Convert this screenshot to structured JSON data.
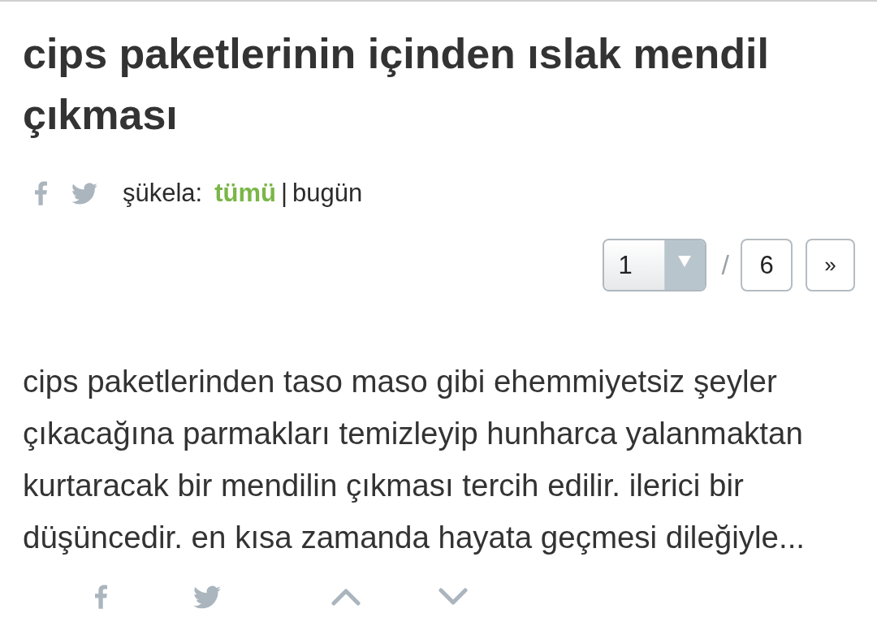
{
  "title": "cips paketlerinin içinden ıslak mendil çıkması",
  "sukela": {
    "label": "şükela:",
    "options": [
      {
        "label": "tümü",
        "selected": true
      },
      {
        "label": "bugün",
        "selected": false
      }
    ],
    "separator": "|"
  },
  "pager": {
    "current": "1",
    "separator": "/",
    "total": "6",
    "next": "»"
  },
  "entry": {
    "text": "cips paketlerinden taso maso gibi ehemmiyetsiz şeyler çıkacağına parmakları temizleyip hunharca yalanmaktan kurtaracak bir mendilin çıkması tercih edilir. ilerici bir düşüncedir. en kısa zamanda hayata geçmesi dileğiyle..."
  }
}
